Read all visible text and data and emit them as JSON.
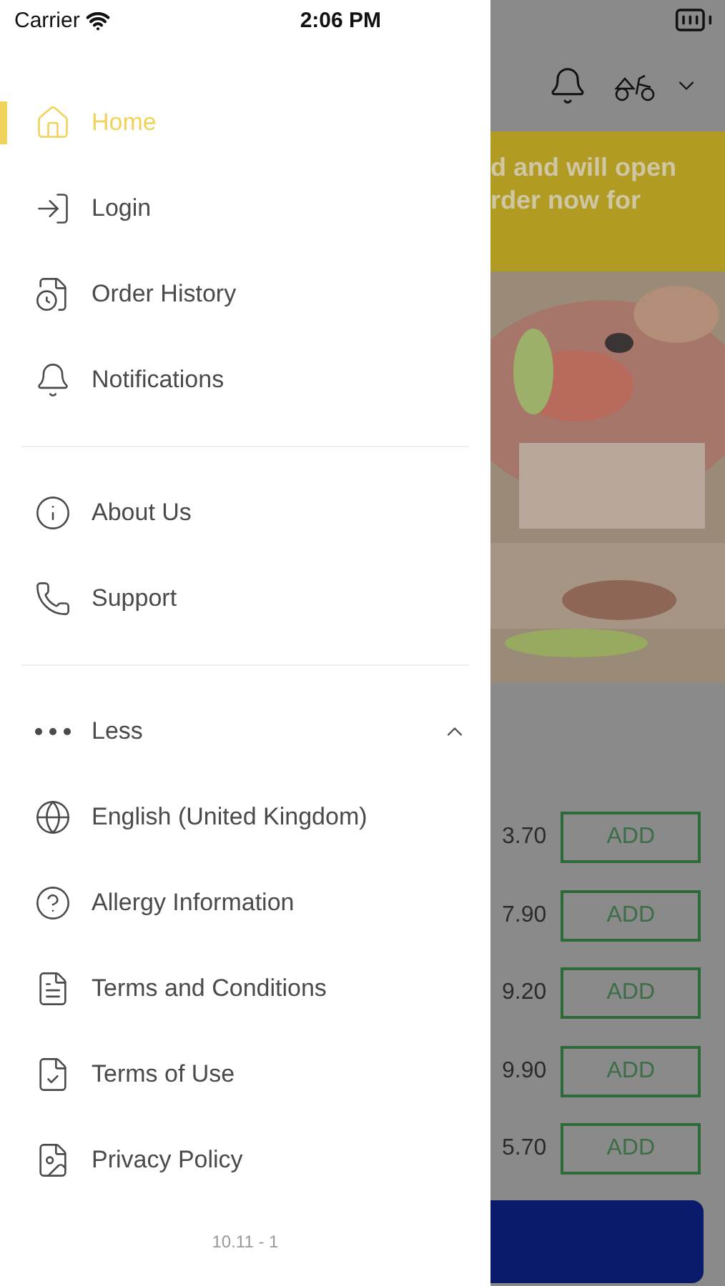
{
  "status_bar": {
    "carrier": "Carrier",
    "time": "2:06 PM"
  },
  "drawer": {
    "sections": [
      {
        "items": [
          {
            "label": "Home",
            "selected": true
          },
          {
            "label": "Login",
            "selected": false
          },
          {
            "label": "Order History",
            "selected": false
          },
          {
            "label": "Notifications",
            "selected": false
          }
        ]
      },
      {
        "items": [
          {
            "label": "About Us",
            "selected": false
          },
          {
            "label": "Support",
            "selected": false
          }
        ]
      }
    ],
    "more_toggle": {
      "label": "Less",
      "expanded": true
    },
    "more_items": [
      {
        "label": "English (United Kingdom)",
        "selected": false
      },
      {
        "label": "Allergy Information",
        "selected": false
      },
      {
        "label": "Terms and Conditions",
        "selected": false
      },
      {
        "label": "Terms of Use",
        "selected": false
      },
      {
        "label": "Privacy Policy",
        "selected": false
      }
    ],
    "version": "10.11 - 1"
  },
  "background": {
    "banner_lines": [
      "d and will open",
      "rder now for"
    ],
    "products": [
      {
        "price": "3.70",
        "button": "ADD"
      },
      {
        "price": "7.90",
        "button": "ADD"
      },
      {
        "price": "9.20",
        "button": "ADD"
      },
      {
        "price": "9.90",
        "button": "ADD"
      },
      {
        "price": "5.70",
        "button": "ADD"
      }
    ]
  }
}
